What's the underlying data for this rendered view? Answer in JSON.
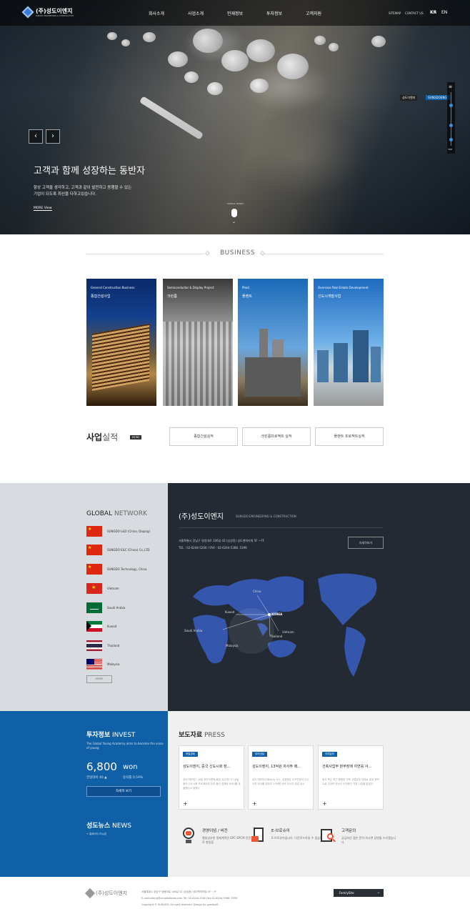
{
  "header": {
    "logo_text": "(주)성도이엔지",
    "logo_sub": "SUNGDO ENGINEERING & CONSTRUCTION",
    "nav": [
      "회사소개",
      "사업소개",
      "인재정보",
      "투자정보",
      "고객지원"
    ],
    "util": [
      "SITEMAP",
      "CONTACT US"
    ],
    "lang": [
      "KR",
      "EN"
    ]
  },
  "hero": {
    "headline": "고객과 함께 성장하는 동반자",
    "desc_line1": "항상 고객을 생각하고, 고객과 같이 발전하고 동행할 수 있는",
    "desc_line2": "기업이 되도록 최선을 다하고있습니다.",
    "more": "MORE View",
    "scroll": "SCROLL DOWN",
    "side_tag1": "성도이엔지",
    "side_tag2": "SUNGDOENG",
    "top": "TOP"
  },
  "business": {
    "title": "BUSINESS",
    "cards": [
      {
        "en": "General Construction Business",
        "ko": "종합건설사업"
      },
      {
        "en": "Semiconductor & Display Project",
        "ko": "크린룸"
      },
      {
        "en": "Plant",
        "ko": "플랜트"
      },
      {
        "en": "Overseas Real Estate Development",
        "ko": "신도시개발사업"
      }
    ]
  },
  "performance": {
    "title_bold": "사업",
    "title_light": "실적",
    "more": "MORE",
    "buttons": [
      "종합건설실적",
      "크린룸프로젝트 실적",
      "플랜트 프로젝트실적"
    ]
  },
  "network": {
    "title_bold": "GLOBAL",
    "title_light": " NETWORK",
    "items": [
      "SUNGDO L&D (China, Daqing)",
      "SUNGDO E&C (China) Co.,LTD",
      "SUNGDO Technology, China",
      "Vietnam",
      "Saudi Arabia",
      "Kuwait",
      "Thailand",
      "Malaysia"
    ],
    "more": "MORE",
    "company": "(주)성도이엔지",
    "company_en": "SUNGDO ENGINEERING & CONSTRUCTION",
    "address": "서울특별시 강남구 영동대로 106길 42 (삼성동) 성도벤처타워 5F ~7F",
    "tel": "TEL : 02-6244-5200 / FAX : 02-6244-5388, 5399",
    "detail_btn": "자세히보기",
    "map_labels": [
      "China",
      "KOREA",
      "Kuwait",
      "Saudi Arabia",
      "Malaysia",
      "Thailand",
      "Vietnam"
    ]
  },
  "invest": {
    "title_bold": "투자정보",
    "title_light": " INVEST",
    "desc": "The Global Young Academy aims to become the voice of young",
    "price": "6,800",
    "unit": "won",
    "change_label": "전일대비 40 ▲",
    "rate_label": "등락률 0.59%",
    "btn": "자세히 보기"
  },
  "news": {
    "title_bold": "성도뉴스",
    "title_light": " NEWS",
    "link": "+ 홍페이지 리뉴얼"
  },
  "press": {
    "title_bold": "보도자료",
    "title_light": " PRESS",
    "cards": [
      {
        "badge": "매일경제",
        "title": "성도이엔지, 중국 신도시화 장...",
        "body": "성도이엔지는 18일 성도이엔지(회장 강순영) 이 18일 중국 신도시화 프로젝트에 참여 중인 업체와 MOU를 체결했다고 밝혔다"
      },
      {
        "badge": "파이낸셜",
        "title": "성도이엔지, 13억원 자사주 매...",
        "body": "성도이엔지(036540) 사는, 성장형은 주가안정과 주주가치 제고를 위하여 13억원 규모 자사주 매입 공시"
      },
      {
        "badge": "이데일리",
        "title": "건축사업부 본부장에 이연웅 사...",
        "body": "회사 측은 최근 종합한 건축 사업본부 대표로 성장 동력으로 인당의 자산수 이연웅이 직접 사업을 맡았다"
      }
    ]
  },
  "quick": [
    {
      "title": "경영이념 / 비전",
      "desc": "행실상부한 명제계적인 EPC EPCM 전문기업으로 발돋움"
    },
    {
      "title": "E-브로슈어",
      "desc": "E-브로슈어입니다. 다운로드하실 수 있습니다."
    },
    {
      "title": "고객문의",
      "desc": "궁금하신 점은 문의 하시면 답변을 드리겠습니다."
    }
  ],
  "footer": {
    "logo_text": "(주)성도이엔지",
    "address": "서울특별시 강남구 영동대로 106길 42 (삼성동) 성도벤처타워 5F ~7F",
    "contact": "E-mail:sdeng@sungdokorea.com   Tel: 02-6244-5200   Fax:02-6244-5388, 5399",
    "copyright": "Copyright © SUNGDO. All right reserved. Design by gowitsoft",
    "family": "FamilySite"
  },
  "colors": {
    "accent": "#1060a8",
    "dark": "#232a33",
    "light_gray": "#d8dce0"
  }
}
